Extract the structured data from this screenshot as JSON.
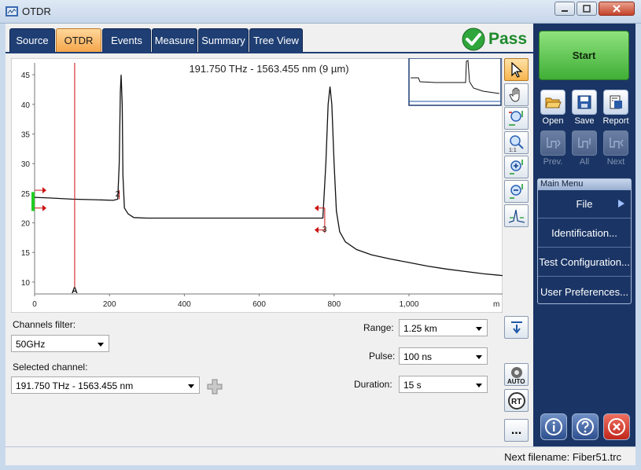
{
  "window": {
    "title": "OTDR"
  },
  "tabs": [
    "Source",
    "OTDR",
    "Events",
    "Measure",
    "Summary",
    "Tree View"
  ],
  "active_tab": "OTDR",
  "status": {
    "label": "Pass",
    "color": "#1f8a2c"
  },
  "graph": {
    "title": "191.750 THz - 1563.455 nm (9 µm)",
    "x_unit": "m",
    "x_ticks": [
      "0",
      "200",
      "400",
      "600",
      "800",
      "1,000"
    ],
    "y_ticks": [
      "45",
      "40",
      "35",
      "30",
      "25",
      "20",
      "15",
      "10"
    ],
    "x_range": [
      0,
      1250
    ],
    "y_range": [
      8,
      47
    ],
    "marker_a": {
      "label": "A",
      "x": 107
    },
    "event_labels": [
      {
        "label": "2",
        "x": 222,
        "y": 25
      },
      {
        "label": "3",
        "x": 775,
        "y": 19
      }
    ],
    "trace": [
      [
        0,
        24.3
      ],
      [
        40,
        24.2
      ],
      [
        100,
        24.0
      ],
      [
        160,
        23.9
      ],
      [
        210,
        23.8
      ],
      [
        222,
        24.0
      ],
      [
        226,
        30
      ],
      [
        229,
        42
      ],
      [
        231,
        45
      ],
      [
        234,
        40
      ],
      [
        236,
        28
      ],
      [
        240,
        22.5
      ],
      [
        250,
        21.5
      ],
      [
        265,
        20.9
      ],
      [
        300,
        20.8
      ],
      [
        500,
        20.8
      ],
      [
        700,
        20.8
      ],
      [
        770,
        20.8
      ],
      [
        778,
        30
      ],
      [
        784,
        40
      ],
      [
        789,
        43
      ],
      [
        794,
        40
      ],
      [
        800,
        30
      ],
      [
        806,
        22
      ],
      [
        815,
        18.5
      ],
      [
        830,
        16.8
      ],
      [
        860,
        15.5
      ],
      [
        900,
        14.6
      ],
      [
        950,
        13.9
      ],
      [
        1000,
        13.3
      ],
      [
        1050,
        12.7
      ],
      [
        1100,
        12.2
      ],
      [
        1150,
        11.8
      ],
      [
        1200,
        11.4
      ],
      [
        1250,
        11.1
      ]
    ],
    "colors": {
      "trace": "#111111",
      "marker": "#cc1111",
      "accent": "#22cc22"
    }
  },
  "filters": {
    "channels_label": "Channels filter:",
    "channels_value": "50GHz",
    "selected_label": "Selected channel:",
    "selected_value": "191.750 THz - 1563.455 nm"
  },
  "acquisition": {
    "range_label": "Range:",
    "range_value": "1.25 km",
    "pulse_label": "Pulse:",
    "pulse_value": "100 ns",
    "duration_label": "Duration:",
    "duration_value": "15 s"
  },
  "tools": {
    "auto_label": "AUTO",
    "rt_label": "RT",
    "more_label": "..."
  },
  "footer": {
    "next_filename": "Next filename: Fiber51.trc"
  },
  "sidebar": {
    "start": "Start",
    "file_buttons": [
      {
        "label": "Open",
        "icon": "folder-open-icon"
      },
      {
        "label": "Save",
        "icon": "save-icon"
      },
      {
        "label": "Report",
        "icon": "report-icon"
      }
    ],
    "nav_buttons": [
      {
        "label": "Prev.",
        "icon": "prev-trace-icon"
      },
      {
        "label": "All",
        "icon": "all-traces-icon"
      },
      {
        "label": "Next",
        "icon": "next-trace-icon"
      }
    ],
    "menu_title": "Main Menu",
    "menu_items": [
      "File",
      "Identification...",
      "Test Configuration...",
      "User Preferences..."
    ]
  }
}
